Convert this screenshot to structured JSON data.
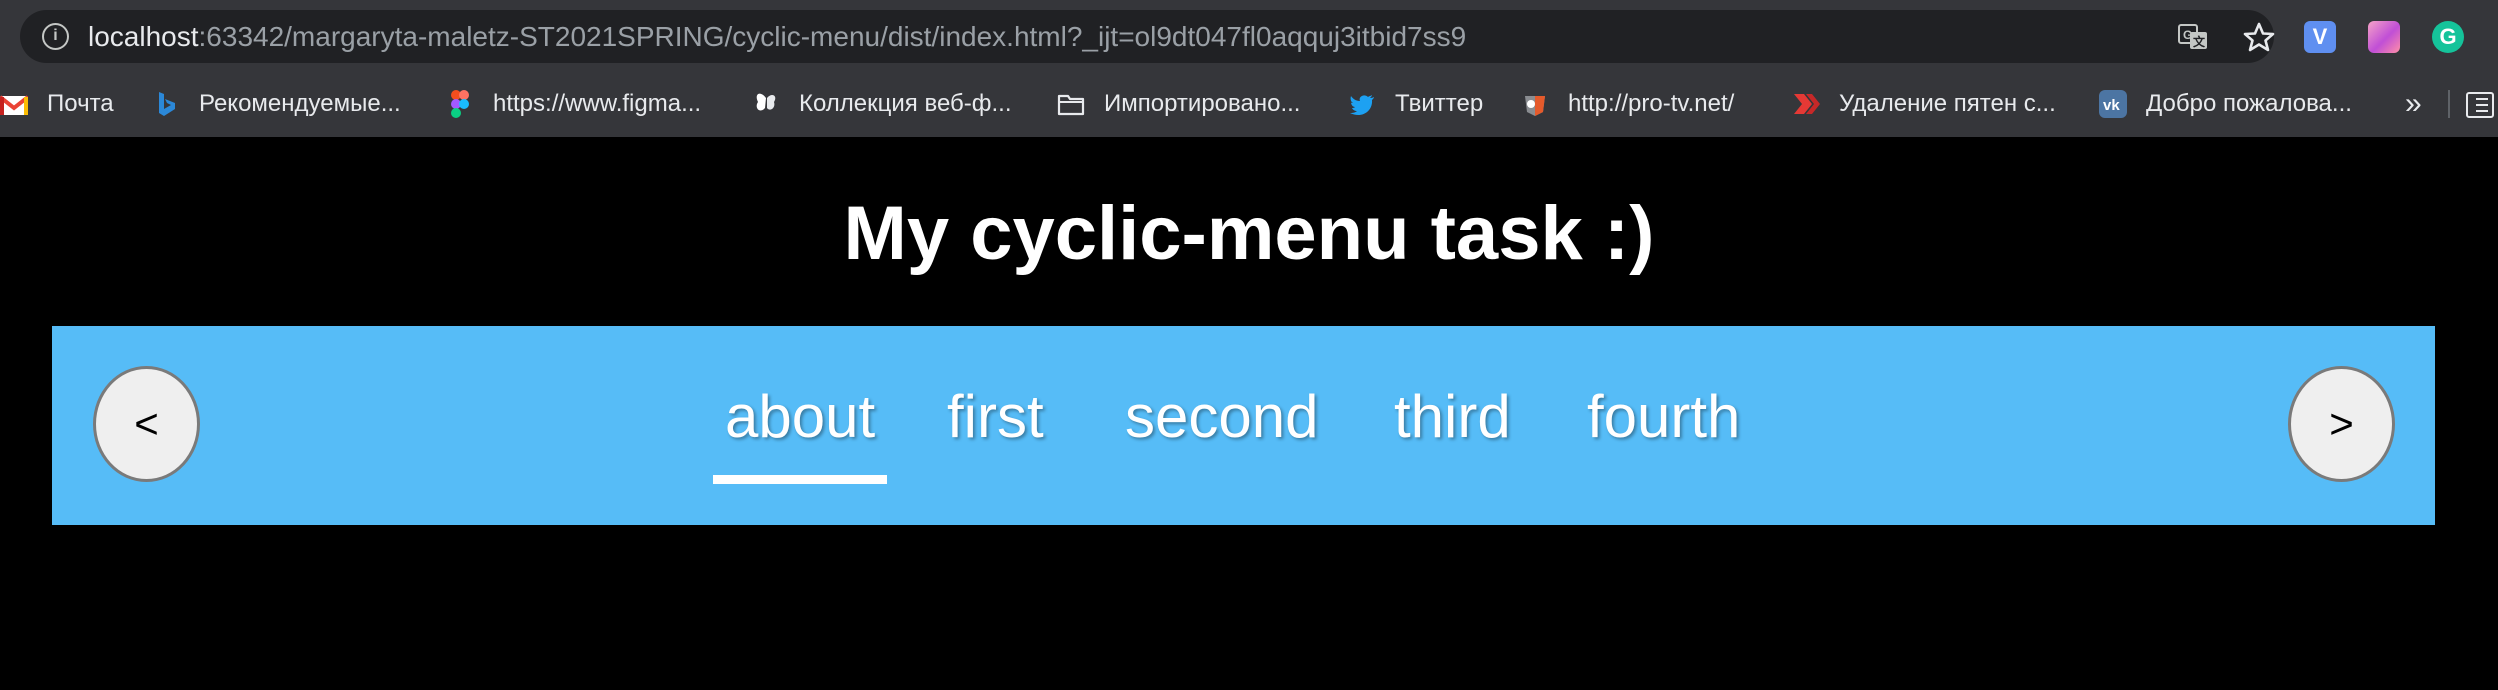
{
  "browser": {
    "url_host": "localhost",
    "url_rest": ":63342/margaryta-maletz-ST2021SPRING/cyclic-menu/dist/index.html?_ijt=ol9dt047fl0aqquj3itbid7ss9",
    "info_icon": "info-icon",
    "translate_icon": "translate-icon",
    "star_icon": "star-icon",
    "extensions": [
      {
        "name": "v-extension-icon",
        "glyph": "V"
      },
      {
        "name": "pink-extension-icon",
        "glyph": ""
      },
      {
        "name": "grammarly-extension-icon",
        "glyph": "G"
      }
    ]
  },
  "bookmarks": {
    "items": [
      {
        "label": "Почта",
        "icon": "gmail-icon"
      },
      {
        "label": "Рекомендуемые...",
        "icon": "bing-icon"
      },
      {
        "label": "https://www.figma...",
        "icon": "figma-icon"
      },
      {
        "label": "Коллекция веб-ф...",
        "icon": "butterfly-icon"
      },
      {
        "label": "Импортировано...",
        "icon": "folder-icon"
      },
      {
        "label": "Твиттер",
        "icon": "twitter-icon"
      },
      {
        "label": "http://pro-tv.net/",
        "icon": "pro-tv-icon"
      },
      {
        "label": "Удаление пятен с...",
        "icon": "red-arrow-icon"
      },
      {
        "label": "Добро пожалова...",
        "icon": "vk-icon"
      }
    ],
    "overflow": "»",
    "reading_list_icon": "reading-list-icon"
  },
  "page": {
    "title": "My cyclic-menu task :)"
  },
  "menu": {
    "prev_label": "<",
    "next_label": ">",
    "items": [
      "about",
      "first",
      "second",
      "third",
      "fourth"
    ],
    "active_index": 0,
    "bar_color": "#56bcf7"
  }
}
